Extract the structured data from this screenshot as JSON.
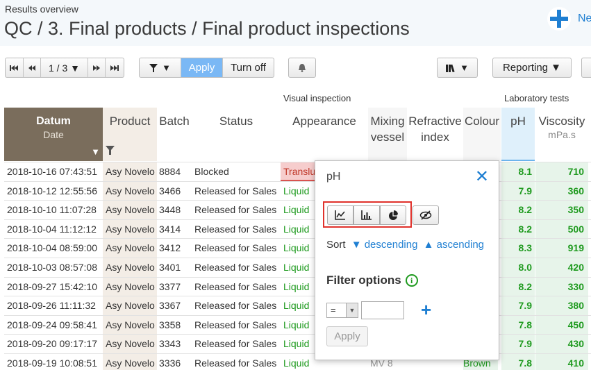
{
  "header": {
    "breadcrumb_small": "Results overview",
    "title": "QC / 3. Final products / Final product inspections",
    "new_label": "Ne"
  },
  "toolbar": {
    "page": "1 / 3 ▼",
    "filter_label": "▼",
    "apply_label": "Apply",
    "turnoff_label": "Turn off",
    "library_label": "▼",
    "reporting_label": "Reporting ▼"
  },
  "groups": {
    "visual": "Visual inspection",
    "lab": "Laboratory tests"
  },
  "columns": {
    "datum": "Datum",
    "datum_sub": "Date",
    "product": "Product",
    "batch": "Batch",
    "status": "Status",
    "appearance": "Appearance",
    "mixing": "Mixing vessel",
    "refractive": "Refractive index",
    "colour": "Colour",
    "ph": "pH",
    "viscosity": "Viscosity",
    "viscosity_unit": "mPa.s"
  },
  "rows": [
    {
      "date": "2018-10-16 07:43:51",
      "product": "Asy Novelo",
      "batch": "8884",
      "status": "Blocked",
      "appearance": "Transluc",
      "ph": "8.1",
      "visc": "710"
    },
    {
      "date": "2018-10-12 12:55:56",
      "product": "Asy Novelo",
      "batch": "3466",
      "status": "Released for Sales",
      "appearance": "Liquid",
      "ph": "7.9",
      "visc": "360"
    },
    {
      "date": "2018-10-10 11:07:28",
      "product": "Asy Novelo",
      "batch": "3448",
      "status": "Released for Sales",
      "appearance": "Liquid",
      "ph": "8.2",
      "visc": "350"
    },
    {
      "date": "2018-10-04 11:12:12",
      "product": "Asy Novelo",
      "batch": "3414",
      "status": "Released for Sales",
      "appearance": "Liquid",
      "ph": "8.2",
      "visc": "500"
    },
    {
      "date": "2018-10-04 08:59:00",
      "product": "Asy Novelo",
      "batch": "3412",
      "status": "Released for Sales",
      "appearance": "Liquid",
      "ph": "8.3",
      "visc": "919"
    },
    {
      "date": "2018-10-03 08:57:08",
      "product": "Asy Novelo",
      "batch": "3401",
      "status": "Released for Sales",
      "appearance": "Liquid",
      "ph": "8.0",
      "visc": "420"
    },
    {
      "date": "2018-09-27 15:42:10",
      "product": "Asy Novelo",
      "batch": "3377",
      "status": "Released for Sales",
      "appearance": "Liquid",
      "ph": "8.2",
      "visc": "330"
    },
    {
      "date": "2018-09-26 11:11:32",
      "product": "Asy Novelo",
      "batch": "3367",
      "status": "Released for Sales",
      "appearance": "Liquid",
      "ph": "7.9",
      "visc": "380"
    },
    {
      "date": "2018-09-24 09:58:41",
      "product": "Asy Novelo",
      "batch": "3358",
      "status": "Released for Sales",
      "appearance": "Liquid",
      "ph": "7.8",
      "visc": "450"
    },
    {
      "date": "2018-09-20 09:17:17",
      "product": "Asy Novelo",
      "batch": "3343",
      "status": "Released for Sales",
      "appearance": "Liquid",
      "ph": "7.9",
      "visc": "430"
    },
    {
      "date": "2018-09-19 10:08:51",
      "product": "Asy Novelo",
      "batch": "3336",
      "status": "Released for Sales",
      "appearance": "Liquid",
      "ph": "7.8",
      "visc": "410",
      "mixing": "MV 8",
      "colour": "Brown"
    }
  ],
  "popup": {
    "title": "pH",
    "close": "✕",
    "sort_label": "Sort",
    "sort_desc": "▼ descending",
    "sort_asc": "▲ ascending",
    "filter_title": "Filter options",
    "info": "i",
    "operator": "=",
    "add": "+",
    "apply": "Apply"
  }
}
